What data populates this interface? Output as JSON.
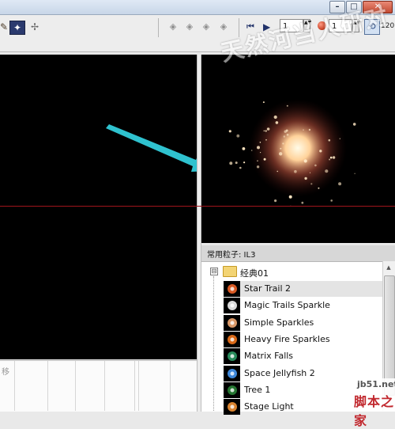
{
  "window": {
    "minimize_glyph": "–",
    "maximize_glyph": "□",
    "close_glyph": "✕"
  },
  "toolbar": {
    "tool_a_icon": "brush-icon",
    "tool_a_glyph": "✎",
    "tool_b_icon": "particle-tool-icon",
    "tool_b_glyph": "✦",
    "tool_c_icon": "emitter-icon",
    "tool_c_glyph": "✢",
    "nav_glyphs": [
      "◈",
      "◈",
      "◈",
      "◈"
    ],
    "skip_start_glyph": "⏮",
    "play_glyph": "▶",
    "frame_value": "1",
    "speed_value": "1",
    "spin_arrows_glyph": "▲▼",
    "loop_glyph": "⟲",
    "fps_value": "120"
  },
  "watermark": {
    "text": "天然河当人研对"
  },
  "timeline": {
    "label": "移"
  },
  "library": {
    "title": "常用粒子: IL3",
    "folder": {
      "toggle": "⊟",
      "name": "经典01"
    },
    "items": [
      {
        "label": "Star Trail 2",
        "color": "#ff6a2a"
      },
      {
        "label": "Magic Trails Sparkle",
        "color": "#ffffff"
      },
      {
        "label": "Simple Sparkles",
        "color": "#ffb37a"
      },
      {
        "label": "Heavy Fire Sparkles",
        "color": "#ff7b1c"
      },
      {
        "label": "Matrix Falls",
        "color": "#2fa36b"
      },
      {
        "label": "Space Jellyfish 2",
        "color": "#4aa0ff"
      },
      {
        "label": "Tree 1",
        "color": "#2c8a3a"
      },
      {
        "label": "Stage Light",
        "color": "#ff9b3a"
      }
    ],
    "scroll_up_glyph": "▲"
  },
  "site": {
    "url": "jb51.net",
    "name": "脚本之家"
  },
  "colors": {
    "accent_arrow": "#2fc2cf",
    "redline": "#a0141b",
    "particle_core": "#fff2d6"
  }
}
